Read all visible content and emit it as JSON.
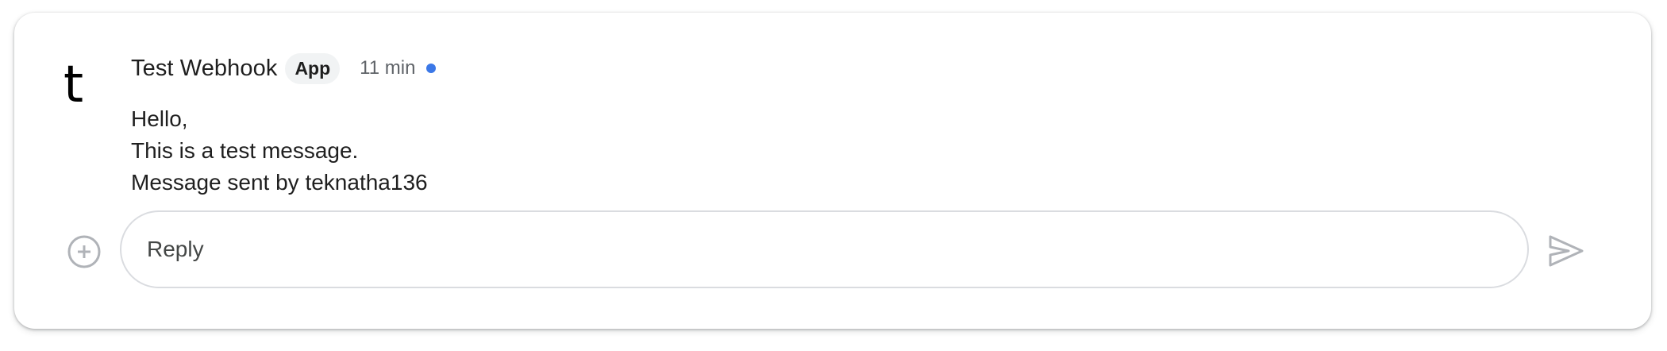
{
  "message": {
    "avatar_letter": "t",
    "sender_name": "Test Webhook",
    "badge": "App",
    "timestamp": "11 min",
    "lines": [
      "Hello,",
      "This is a test message.",
      "Message sent by teknatha136"
    ]
  },
  "reply": {
    "placeholder": "Reply",
    "value": ""
  },
  "icons": {
    "avatar": "avatar-t-icon",
    "add": "add-circle-icon",
    "send": "send-icon",
    "status": "unread-dot-icon"
  },
  "colors": {
    "status_dot": "#3b78e7",
    "icon_gray": "#b0b3b8",
    "badge_bg": "#f1f3f4"
  }
}
